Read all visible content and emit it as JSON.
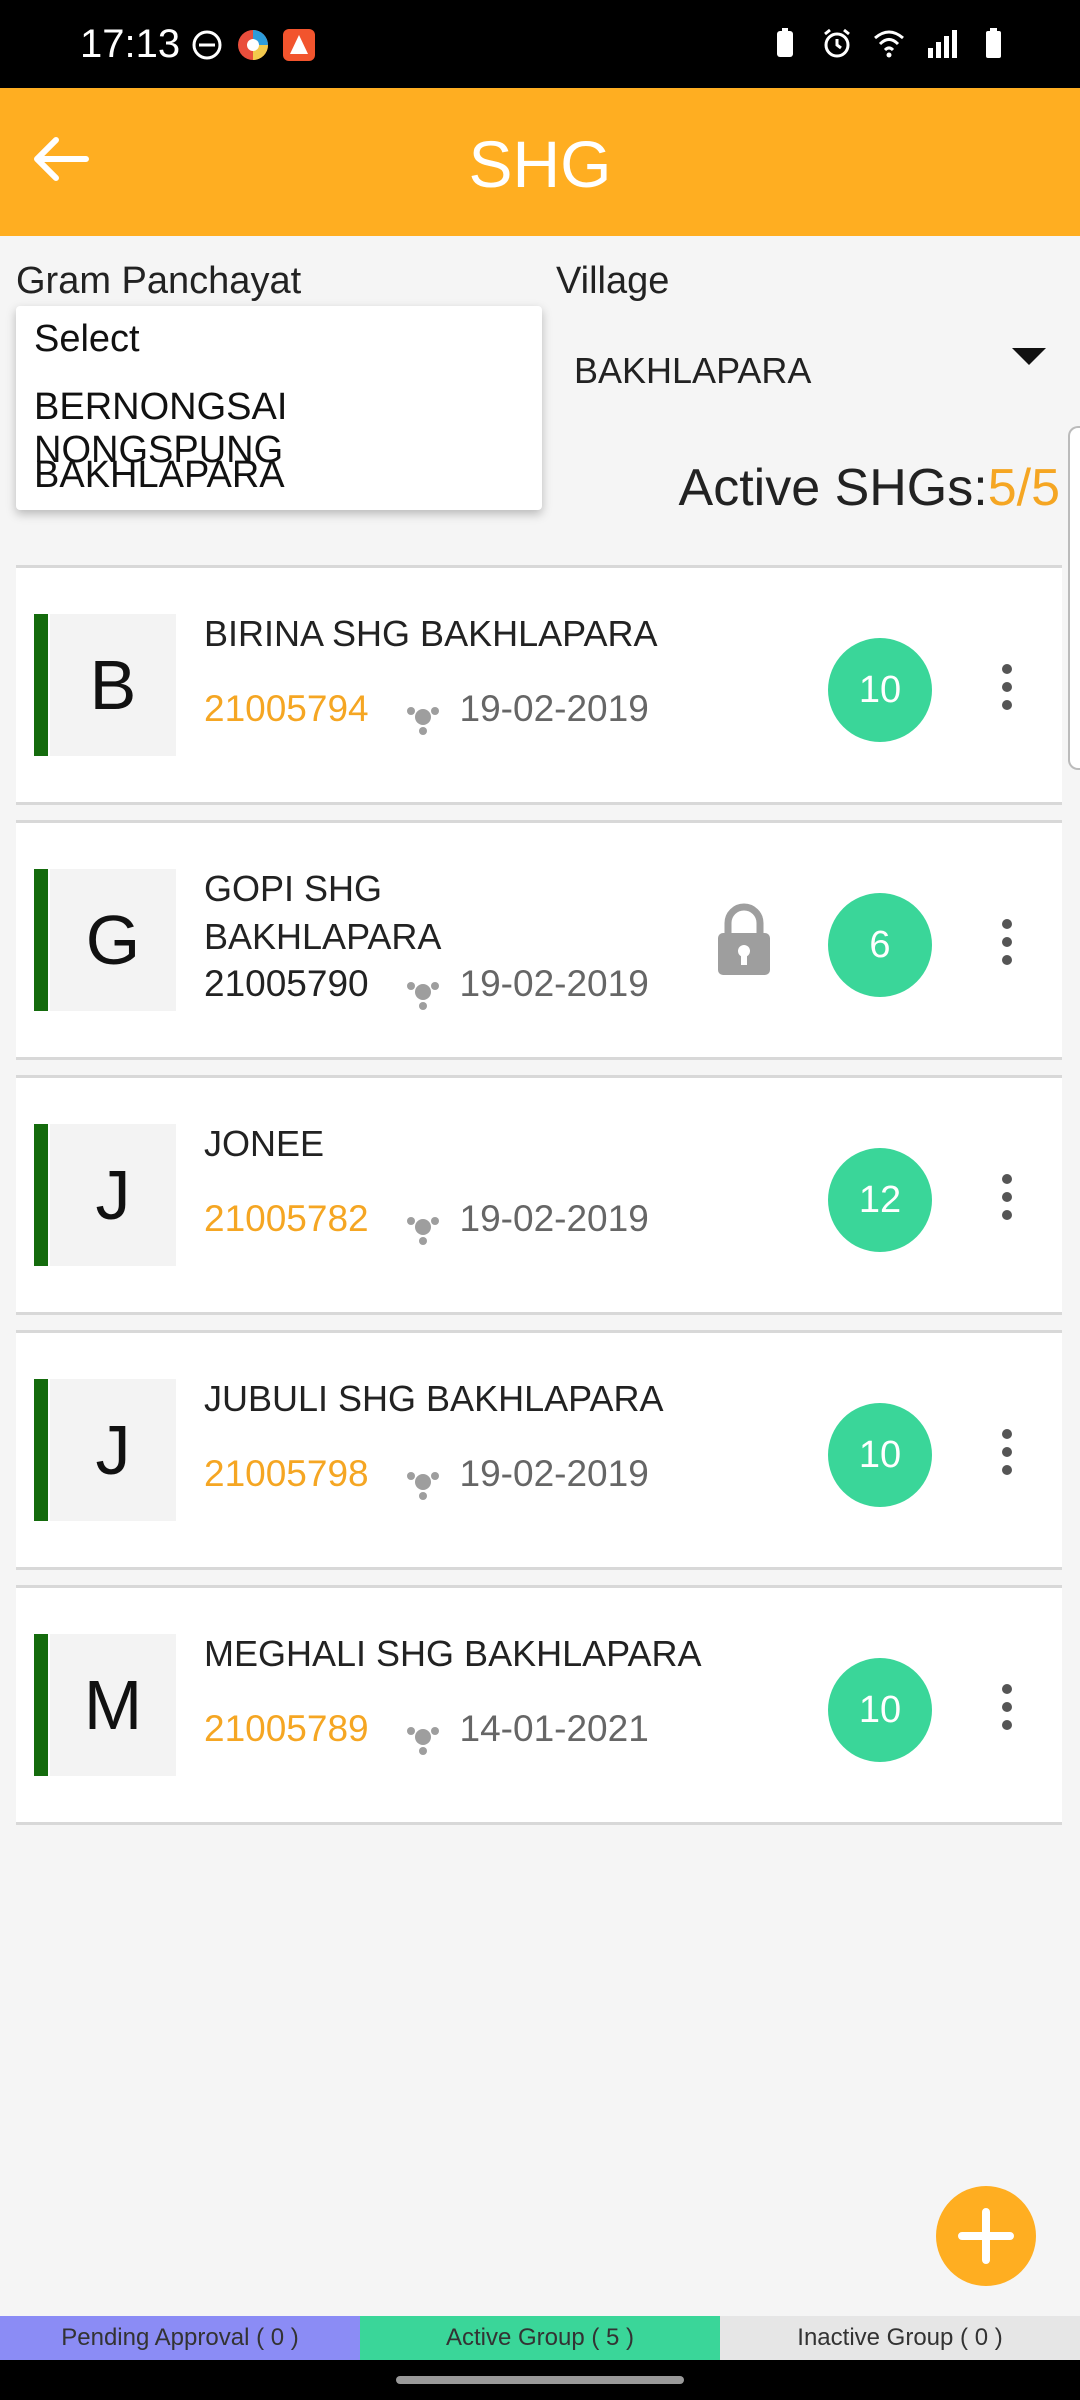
{
  "status": {
    "time": "17:13"
  },
  "header": {
    "title": "SHG"
  },
  "filters": {
    "gram_panchayat_label": "Gram Panchayat",
    "village_label": "Village",
    "village_value": "BAKHLAPARA",
    "dropdown_options": [
      "Select",
      "BERNONGSAI NONGSPUNG",
      "BAKHLAPARA"
    ]
  },
  "summary": {
    "label": "Active SHGs:",
    "count": "5/5"
  },
  "shgs": [
    {
      "initial": "B",
      "name": "BIRINA SHG BAKHLAPARA",
      "code": "21005794",
      "date": "19-02-2019",
      "members": "10",
      "locked": false
    },
    {
      "initial": "G",
      "name": "GOPI SHG BAKHLAPARA",
      "code": "21005790",
      "date": "19-02-2019",
      "members": "6",
      "locked": true
    },
    {
      "initial": "J",
      "name": "JONEE",
      "code": "21005782",
      "date": "19-02-2019",
      "members": "12",
      "locked": false
    },
    {
      "initial": "J",
      "name": "JUBULI SHG BAKHLAPARA",
      "code": "21005798",
      "date": "19-02-2019",
      "members": "10",
      "locked": false
    },
    {
      "initial": "M",
      "name": "MEGHALI SHG BAKHLAPARA",
      "code": "21005789",
      "date": "14-01-2021",
      "members": "10",
      "locked": false
    }
  ],
  "tabs": [
    {
      "label": "Pending Approval ( 0 )",
      "color": "#8b8cf5"
    },
    {
      "label": "Active Group ( 5 )",
      "color": "#3ad699"
    },
    {
      "label": "Inactive Group ( 0 )",
      "color": "#e6e6e6"
    }
  ],
  "colors": {
    "primary": "#ffae21",
    "accent_orange": "#f5a623",
    "badge_green": "#3ad699",
    "bar_green": "#146b0d"
  }
}
